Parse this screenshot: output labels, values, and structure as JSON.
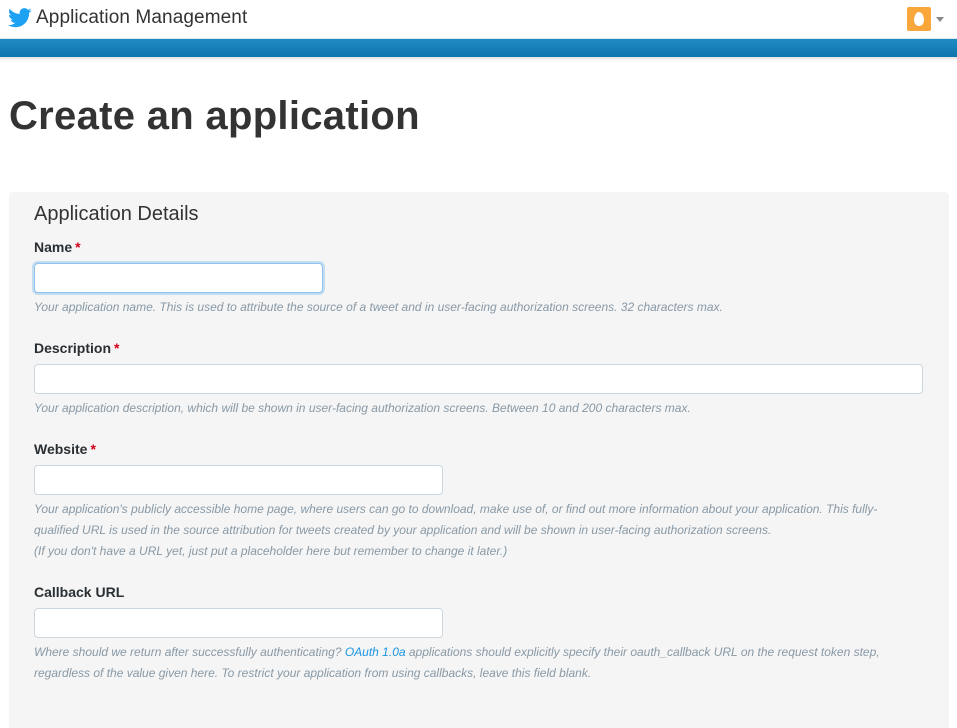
{
  "header": {
    "app_title": "Application Management"
  },
  "page": {
    "title": "Create an application"
  },
  "panel": {
    "title": "Application Details"
  },
  "fields": {
    "name": {
      "label": "Name",
      "required_mark": "*",
      "value": "",
      "help": "Your application name. This is used to attribute the source of a tweet and in user-facing authorization screens. 32 characters max."
    },
    "description": {
      "label": "Description",
      "required_mark": "*",
      "value": "",
      "help": "Your application description, which will be shown in user-facing authorization screens. Between 10 and 200 characters max."
    },
    "website": {
      "label": "Website",
      "required_mark": "*",
      "value": "",
      "help_line1": "Your application's publicly accessible home page, where users can go to download, make use of, or find out more information about your application. This fully-qualified URL is used in the source attribution for tweets created by your application and will be shown in user-facing authorization screens.",
      "help_line2": "(If you don't have a URL yet, just put a placeholder here but remember to change it later.)"
    },
    "callback_url": {
      "label": "Callback URL",
      "value": "",
      "help_prefix": "Where should we return after successfully authenticating? ",
      "help_link": "OAuth 1.0a",
      "help_suffix": " applications should explicitly specify their oauth_callback URL on the request token step, regardless of the value given here. To restrict your application from using callbacks, leave this field blank."
    }
  },
  "colors": {
    "brand_blue": "#1da1f2",
    "header_bar": "#0f74ad",
    "required": "#d0021b",
    "avatar": "#f9a63a"
  },
  "icons": {
    "logo": "twitter-bird-icon",
    "avatar": "egg-avatar-icon",
    "menu": "caret-down-icon"
  }
}
